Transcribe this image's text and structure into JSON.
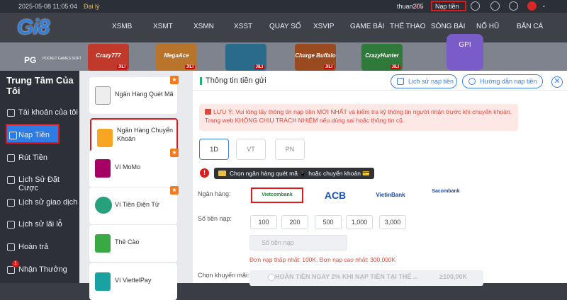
{
  "topbar": {
    "datetime": "2025-05-08 11:05:04",
    "language": "Đại lý",
    "username": "thuan205",
    "balance": "0K",
    "deposit_label": "Nạp tiền"
  },
  "brand": {
    "logo": "Gi8"
  },
  "nav": [
    "XSMB",
    "XSMT",
    "XSMN",
    "XSST",
    "QUAY SỐ",
    "XSVIP",
    "GAME BÀI",
    "THỂ THAO",
    "SÒNG BÀI",
    "NỔ HŨ",
    "BẮN CÁ"
  ],
  "banner": {
    "provider": "PG",
    "provider_sub": "POCKET GAMES SOFT",
    "tiles": [
      {
        "name": "Crazy777",
        "tag": "JILI",
        "color": "#c0392b"
      },
      {
        "name": "MegaAce",
        "tag": "JILI",
        "color": "#b8742a"
      },
      {
        "name": "",
        "tag": "JILI",
        "color": "#2a6b8c"
      },
      {
        "name": "Charge Buffalo",
        "tag": "JILI",
        "color": "#9a4a1f"
      },
      {
        "name": "CrazyHunter",
        "tag": "JILI",
        "color": "#2f7a3a"
      }
    ],
    "gpi": "GPI"
  },
  "sidebar": {
    "title": "Trung Tâm Của Tôi",
    "items": [
      {
        "label": "Tài khoản của tôi",
        "icon": "user-icon"
      },
      {
        "label": "Nạp Tiền",
        "icon": "deposit-icon",
        "active": true
      },
      {
        "label": "Rút Tiền",
        "icon": "withdraw-icon"
      },
      {
        "label": "Lịch Sử Đặt Cược",
        "icon": "history-icon"
      },
      {
        "label": "Lịch sử giao dịch",
        "icon": "transaction-icon"
      },
      {
        "label": "Lịch sử lãi lỗ",
        "icon": "profit-icon"
      },
      {
        "label": "Hoàn trả",
        "icon": "refund-icon"
      },
      {
        "label": "Nhận Thưởng",
        "icon": "gift-icon",
        "badge": "1"
      }
    ]
  },
  "methods": [
    {
      "label": "Ngân Hàng Quét Mã",
      "icon": "qr-icon",
      "color": "#eeeeee"
    },
    {
      "label": "Ngân Hàng Chuyển Khoản",
      "icon": "bank-transfer-icon",
      "color": "#f6a623",
      "selected": true
    },
    {
      "label": "Ví MoMo",
      "icon": "momo-icon",
      "color": "#a50064"
    },
    {
      "label": "Ví Tiền Điện Tử",
      "icon": "tether-icon",
      "color": "#26a17b"
    },
    {
      "label": "Thẻ Cào",
      "icon": "card-icon",
      "color": "#3aa845"
    },
    {
      "label": "Ví ViettelPay",
      "icon": "viettelpay-icon",
      "color": "#1aa1a1"
    }
  ],
  "main": {
    "title": "Thông tin tiền gửi",
    "history_btn": "Lịch sử nạp tiền",
    "guide_btn": "Hướng dẫn nạp tiền",
    "warning": "LƯU Ý: Vui lòng lấy thông tin nạp tiền MỚI NHẤT và kiểm tra kỹ thông tin người nhận trước khi chuyển khoản. Trang web KHÔNG CHỊU TRÁCH NHIỆM nếu dùng sai hoặc thông tin cũ.",
    "tabs": [
      "1D",
      "VT",
      "PN"
    ],
    "tip": "Chọn ngân hàng quét mã 📱 hoặc chuyển khoản 💳",
    "bank_label": "Ngân hàng:",
    "banks": [
      "Vietcombank",
      "ACB",
      "VietinBank",
      "Sacombank"
    ],
    "amount_label": "Số tiền nạp:",
    "amounts": [
      "100",
      "200",
      "500",
      "1,000",
      "3,000"
    ],
    "amount_placeholder": "Số tiền nạp",
    "min_max": "Đơn nạp thấp nhất: 100K, Đơn nạp cao nhất: 300,000K",
    "promo_label": "Chọn khuyến mãi:",
    "promo_text": "HOÀN TIỀN NGAY 2% KHI NẠP TIỀN TẠI THỂ ...",
    "promo_value": "≥100,00K"
  }
}
